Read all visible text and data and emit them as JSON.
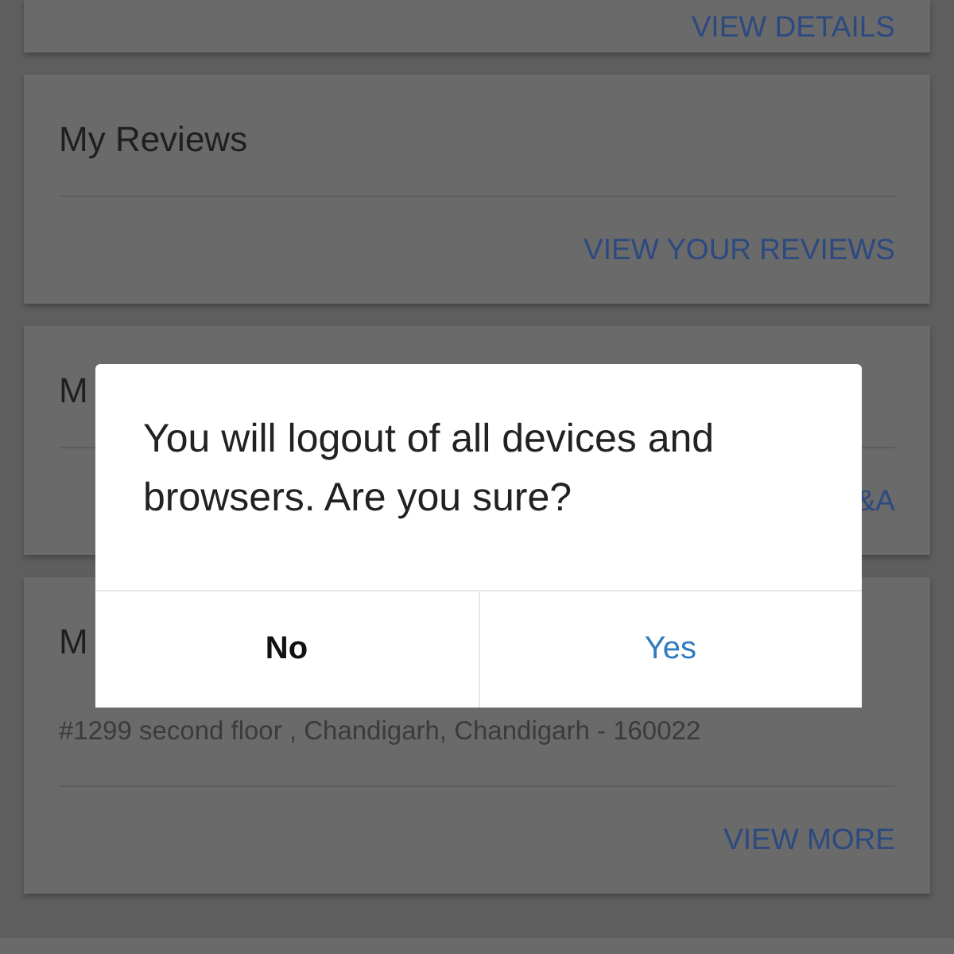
{
  "cards": [
    {
      "link": "VIEW DETAILS"
    },
    {
      "title": "My Reviews",
      "link": "VIEW YOUR REVIEWS"
    },
    {
      "title": "M",
      "link": "&A"
    },
    {
      "title": "M",
      "address": "#1299 second floor , Chandigarh, Chandigarh - 160022",
      "link": "VIEW MORE"
    }
  ],
  "dialog": {
    "message": "You will logout of all devices and browsers. Are you sure?",
    "buttons": [
      {
        "label": "No",
        "kind": "cancel"
      },
      {
        "label": "Yes",
        "kind": "confirm"
      }
    ]
  }
}
